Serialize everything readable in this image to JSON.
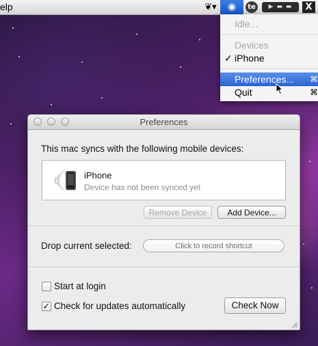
{
  "menubar": {
    "help_label": "elp",
    "status_icons": [
      "butterfly-icon",
      "eye-icon",
      "te-icon",
      "player-icon",
      "x-app-icon"
    ]
  },
  "menu": {
    "status_label": "Idle...",
    "devices_header": "Devices",
    "device_checkmark": "✓",
    "device_label": "iPhone",
    "preferences_label": "Preferences...",
    "preferences_shortcut": "⌘",
    "quit_label": "Quit",
    "quit_shortcut": "⌘"
  },
  "prefs_window": {
    "title": "Preferences",
    "sync_heading": "This mac syncs with the following mobile devices:",
    "devices": [
      {
        "name": "iPhone",
        "status": "Device has not been synced yet"
      }
    ],
    "remove_button": "Remove Device",
    "add_button": "Add Device...",
    "drop_label": "Drop current selected:",
    "shortcut_placeholder": "Click to record shortcut",
    "start_at_login_label": "Start at login",
    "start_at_login_checked": false,
    "check_updates_label": "Check for updates automatically",
    "check_updates_checked": true,
    "check_now_button": "Check Now"
  },
  "colors": {
    "menu_highlight": "#2a62d6",
    "desktop": "#4a2065"
  }
}
